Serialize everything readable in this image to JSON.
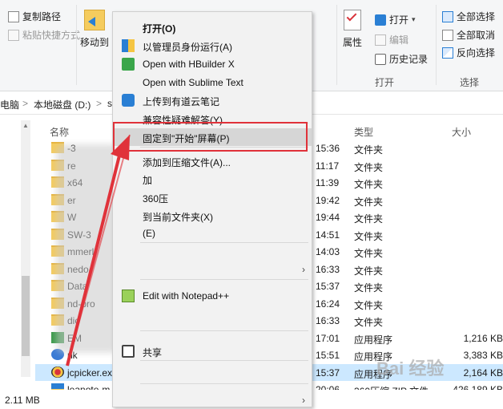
{
  "ribbon": {
    "copy_path": "复制路径",
    "paste_shortcut": "粘贴快捷方式",
    "move_to": "移动到",
    "properties": "属性",
    "open": "打开",
    "edit": "编辑",
    "history": "历史记录",
    "open_group": "打开",
    "select_all": "全部选择",
    "select_none": "全部取消",
    "invert_select": "反向选择",
    "select_group": "选择"
  },
  "address": {
    "pc": "电脑",
    "drive": "本地磁盘 (D:)",
    "sep": ">",
    "tail": "s"
  },
  "columns": {
    "name": "名称",
    "type": "类型",
    "size": "大小"
  },
  "files": [
    {
      "name": "-3",
      "time": "15:36",
      "type": "文件夹",
      "size": "",
      "kind": "folder"
    },
    {
      "name": "re",
      "time": "11:17",
      "type": "文件夹",
      "size": "",
      "kind": "folder"
    },
    {
      "name": "x64",
      "time": "11:39",
      "type": "文件夹",
      "size": "",
      "kind": "folder"
    },
    {
      "name": "er",
      "time": "19:42",
      "type": "文件夹",
      "size": "",
      "kind": "folder"
    },
    {
      "name": "W",
      "time": "19:44",
      "type": "文件夹",
      "size": "",
      "kind": "folder"
    },
    {
      "name": "SW-3",
      "time": "14:51",
      "type": "文件夹",
      "size": "",
      "kind": "folder"
    },
    {
      "name": "mmerl",
      "time": "14:03",
      "type": "文件夹",
      "size": "",
      "kind": "folder"
    },
    {
      "name": "nedo-",
      "time": "16:33",
      "type": "文件夹",
      "size": "",
      "kind": "folder"
    },
    {
      "name": "Data",
      "time": "15:37",
      "type": "文件夹",
      "size": "",
      "kind": "folder"
    },
    {
      "name": "nd-pro",
      "time": "16:24",
      "type": "文件夹",
      "size": "",
      "kind": "folder"
    },
    {
      "name": "dic",
      "time": "16:33",
      "type": "文件夹",
      "size": "",
      "kind": "folder"
    },
    {
      "name": "EM",
      "time": "17:01",
      "type": "应用程序",
      "size": "1,216 KB",
      "kind": "app"
    },
    {
      "name": "nk",
      "time": "15:51",
      "type": "应用程序",
      "size": "3,383 KB",
      "kind": "app2"
    },
    {
      "name": "jcpicker.ex",
      "time": "15:37",
      "type": "应用程序",
      "size": "2,164 KB",
      "kind": "picker"
    },
    {
      "name": "leanote-m",
      "time": "20:06",
      "type": "360压缩 ZIP 文件",
      "size": "426,189 KB",
      "kind": "zip"
    }
  ],
  "status": {
    "size": "2.11 MB"
  },
  "menu": {
    "items": [
      {
        "label": "打开(O)",
        "bold": true
      },
      {
        "label": "以管理员身份运行(A)",
        "icon": "shield-icon"
      },
      {
        "label": "Open with HBuilder X",
        "icon": "hbuilder-icon"
      },
      {
        "label": "Open with Sublime Text"
      },
      {
        "label": "上传到有道云笔记",
        "icon": "youdao-icon"
      },
      {
        "label": "兼容性疑难解答(Y)"
      },
      {
        "label": "固定到\"开始\"屏幕(P)",
        "highlight": true
      },
      {
        "label": "添加到压缩文件(A)..."
      },
      {
        "label": "加"
      },
      {
        "label": "360压"
      },
      {
        "label": "到当前文件夹(X)"
      },
      {
        "label": "(E)"
      },
      {
        "label": ""
      },
      {
        "label": "Edit with Notepad++",
        "icon": "notepad-icon"
      },
      {
        "label": ""
      },
      {
        "label": "共享",
        "icon": "share-icon"
      },
      {
        "label": ""
      },
      {
        "label": ""
      }
    ]
  },
  "watermark": "Bai 经验",
  "colors": {
    "accent": "#0078d7",
    "highlight_box": "#e0323a",
    "selected_row": "#cce8ff",
    "folder": "#f5cc5e"
  }
}
